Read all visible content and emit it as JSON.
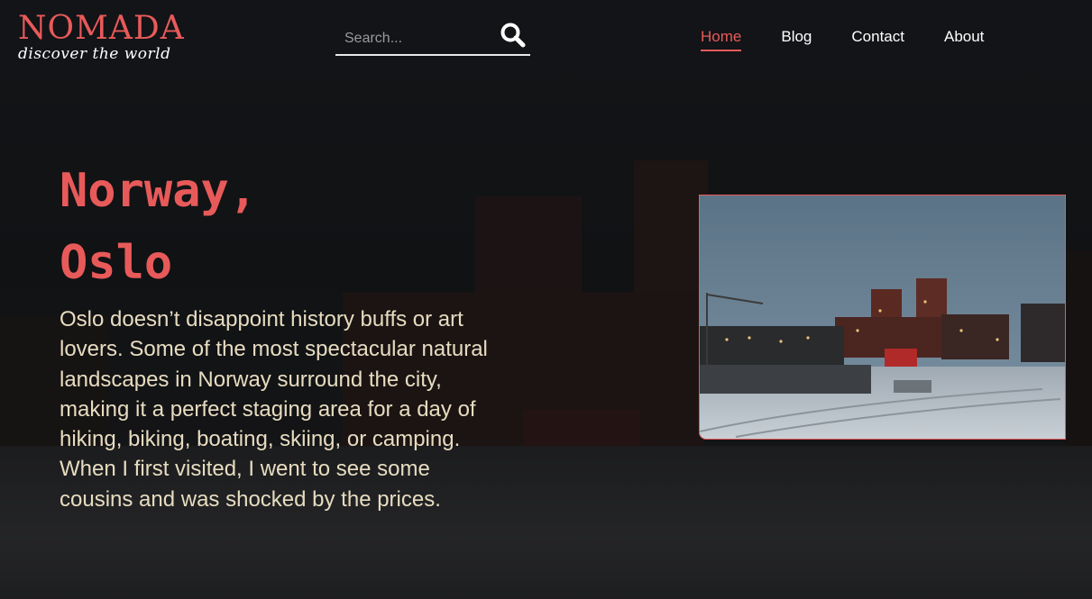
{
  "brand": {
    "name": "NOMADA",
    "tagline": "discover the world"
  },
  "search": {
    "placeholder": "Search..."
  },
  "nav": {
    "items": [
      {
        "label": "Home",
        "active": true
      },
      {
        "label": "Blog",
        "active": false
      },
      {
        "label": "Contact",
        "active": false
      },
      {
        "label": "About",
        "active": false
      }
    ]
  },
  "hero": {
    "title_line1": "Norway,",
    "title_line2": "Oslo",
    "body": "Oslo doesn’t disappoint history buffs or art lovers. Some of the most spectacular natural landscapes in Norway surround the city, making it a perfect staging area for a day of hiking, biking, boating, skiing, or camping. When I first visited, I went to see some cousins and was shocked by the prices."
  },
  "colors": {
    "accent": "#e85a5a",
    "body_text": "#e7dcc0",
    "nav_text": "#ffffff",
    "background": "#141618"
  },
  "icons": {
    "search": "search-icon"
  }
}
